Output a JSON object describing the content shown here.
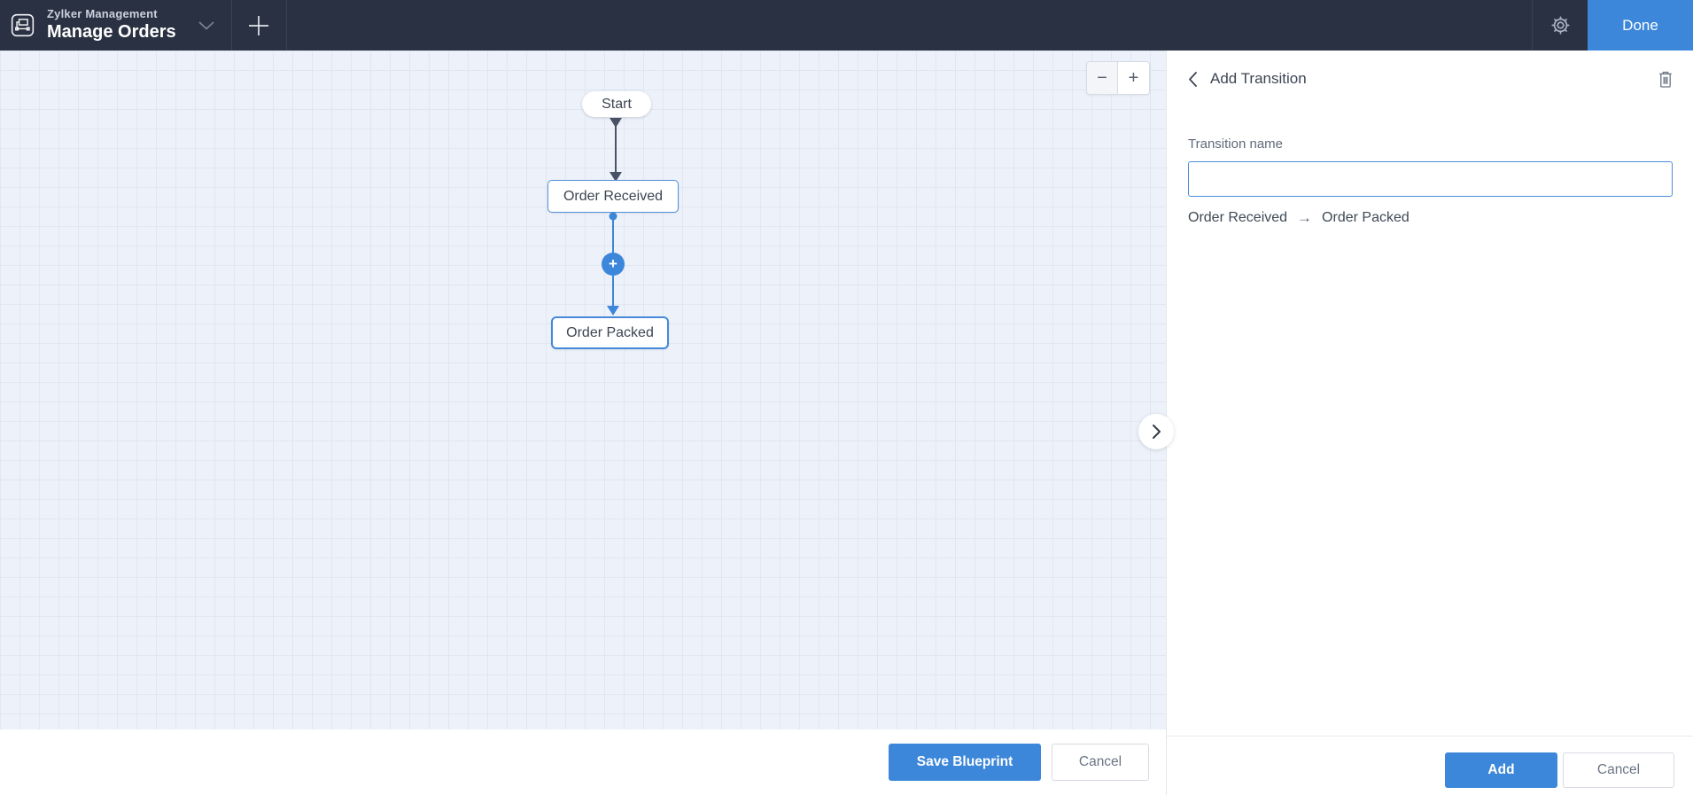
{
  "topbar": {
    "app_name": "Zylker Management",
    "page_title": "Manage Orders",
    "done_label": "Done"
  },
  "canvas": {
    "zoom": {
      "out_label": "−",
      "in_label": "+"
    },
    "workflow": {
      "start_label": "Start",
      "stages": [
        {
          "label": "Order Received"
        },
        {
          "label": "Order Packed"
        }
      ],
      "add_transition_plus": "+"
    },
    "footer": {
      "save_label": "Save Blueprint",
      "cancel_label": "Cancel"
    }
  },
  "panel": {
    "title": "Add Transition",
    "transition_name": {
      "label": "Transition name",
      "value": ""
    },
    "route": {
      "from": "Order Received",
      "arrow": "→",
      "to": "Order Packed"
    },
    "footer": {
      "add_label": "Add",
      "cancel_label": "Cancel"
    }
  },
  "colors": {
    "accent_blue": "#3c87d9",
    "topbar_bg": "#2a3142",
    "stage_border_blue": "#5191da",
    "canvas_bg": "#edf1f9",
    "connector_dark": "#4a5365"
  }
}
